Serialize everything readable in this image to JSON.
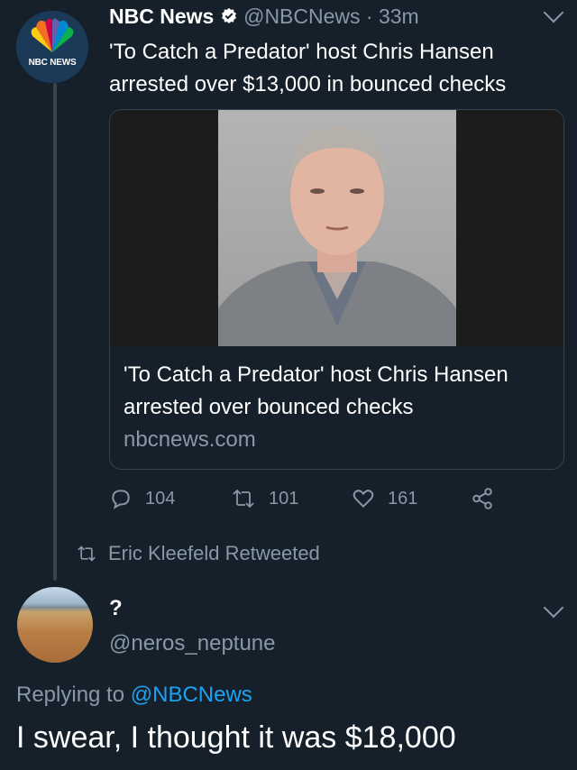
{
  "tweet": {
    "author_name": "NBC News",
    "author_handle": "@NBCNews",
    "separator": "·",
    "time": "33m",
    "text": "'To Catch a Predator' host Chris Hansen arrested over $13,000 in bounced checks",
    "avatar_logo_text": "NBC NEWS",
    "card": {
      "title": "'To Catch a Predator' host Chris Hansen arrested over bounced checks",
      "domain": "nbcnews.com"
    },
    "actions": {
      "replies": "104",
      "retweets": "101",
      "likes": "161"
    }
  },
  "retweet_notice": "Eric Kleefeld Retweeted",
  "reply": {
    "author_name": "?",
    "author_handle": "@neros_neptune",
    "replying_prefix": "Replying to",
    "replying_to": "@NBCNews",
    "text": "I swear, I thought it was $18,000"
  },
  "colors": {
    "background": "#15202b",
    "muted": "#8899a6",
    "link": "#1da1f2",
    "border": "#38444d"
  },
  "icons": [
    "verified-badge-icon",
    "chevron-down-icon",
    "reply-icon",
    "retweet-icon",
    "like-icon",
    "share-icon"
  ]
}
